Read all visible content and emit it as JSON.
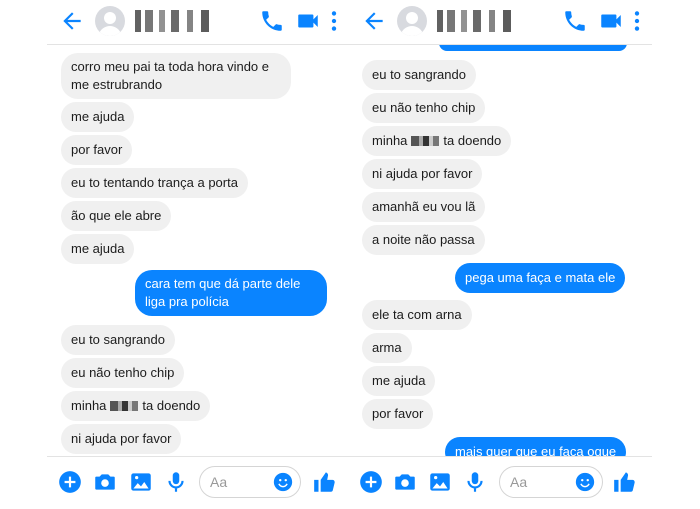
{
  "colors": {
    "accent": "#0a84ff",
    "incoming_bubble": "#f0f0f0",
    "incoming_text": "#1c1c1c",
    "outgoing_text": "#ffffff"
  },
  "header_icons": [
    "back-arrow-icon",
    "avatar",
    "phone-icon",
    "video-call-icon",
    "more-options-icon"
  ],
  "composer": {
    "placeholder": "Aa",
    "icons": [
      "plus-icon",
      "camera-icon",
      "gallery-icon",
      "microphone-icon",
      "emoji-icon",
      "like-thumb-icon"
    ]
  },
  "left_panel": {
    "messages": [
      {
        "dir": "in",
        "text": "corro meu pai ta toda hora vindo e me estrubrando"
      },
      {
        "dir": "in",
        "text": "me ajuda"
      },
      {
        "dir": "in",
        "text": "por favor"
      },
      {
        "dir": "in",
        "text": "eu to tentando trança a porta"
      },
      {
        "dir": "in",
        "text": "ão que ele abre"
      },
      {
        "dir": "in",
        "text": "me ajuda"
      },
      {
        "dir": "out",
        "text": "cara tem que dá parte  dele liga pra polícia"
      },
      {
        "dir": "in",
        "text": "eu to sangrando"
      },
      {
        "dir": "in",
        "text": "eu não tenho chip"
      },
      {
        "dir": "in",
        "text_before": "minha",
        "text_after": "ta doendo"
      },
      {
        "dir": "in",
        "text": "ni ajuda por favor"
      }
    ]
  },
  "right_panel": {
    "messages": [
      {
        "dir": "in",
        "text": "eu to sangrando"
      },
      {
        "dir": "in",
        "text": "eu não tenho chip"
      },
      {
        "dir": "in",
        "text_before": "minha",
        "text_after": "ta doendo"
      },
      {
        "dir": "in",
        "text": "ni ajuda por favor"
      },
      {
        "dir": "in",
        "text": "amanhã eu vou lã"
      },
      {
        "dir": "in",
        "text": "a noite não passa"
      },
      {
        "dir": "out",
        "text": "pega uma faça e mata ele"
      },
      {
        "dir": "in",
        "text": "ele ta com arna"
      },
      {
        "dir": "in",
        "text": "arma"
      },
      {
        "dir": "in",
        "text": "me ajuda"
      },
      {
        "dir": "in",
        "text": "por favor"
      },
      {
        "dir": "out",
        "text": "mais quer que eu faça oque"
      }
    ]
  }
}
